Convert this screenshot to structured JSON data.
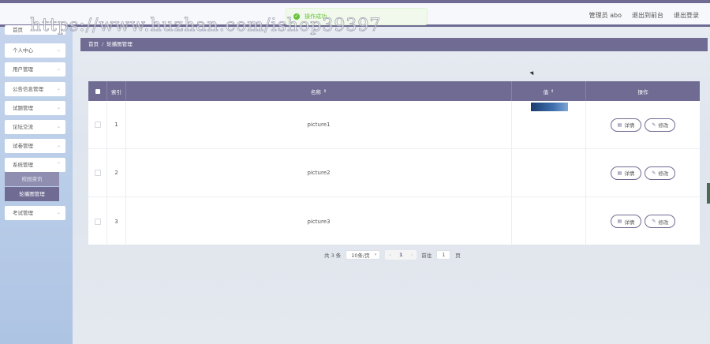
{
  "watermark": "https://www.huzhan.com/ishop39397",
  "toast": {
    "message": "操作成功"
  },
  "header": {
    "user": "管理员 abo",
    "back_to_front": "退出到前台",
    "logout": "退出登录"
  },
  "sidebar": {
    "partial_item": "首页",
    "items": [
      {
        "label": "个人中心"
      },
      {
        "label": "用户管理"
      },
      {
        "label": "公告信息管理"
      },
      {
        "label": "试题管理"
      },
      {
        "label": "论坛交流"
      },
      {
        "label": "试卷管理"
      },
      {
        "label": "系统管理"
      }
    ],
    "submenu": [
      {
        "label": "校园资讯"
      },
      {
        "label": "轮播图管理"
      }
    ],
    "after_items": [
      {
        "label": "考试管理"
      }
    ]
  },
  "breadcrumb": {
    "home": "首页",
    "sep": "/",
    "current": "轮播图管理"
  },
  "table": {
    "headers": {
      "index": "索引",
      "name": "名称",
      "value": "值",
      "actions": "操作"
    },
    "rows": [
      {
        "index": "1",
        "name": "picture1"
      },
      {
        "index": "2",
        "name": "picture2"
      },
      {
        "index": "3",
        "name": "picture3"
      }
    ],
    "detail_label": "详情",
    "edit_label": "修改"
  },
  "pagination": {
    "total": "共 3 条",
    "page_size": "10条/页",
    "current_page": "1",
    "goto_prefix": "前往",
    "goto_value": "1",
    "goto_suffix": "页"
  },
  "colors": {
    "accent": "#6f6b93",
    "success": "#67c23a"
  },
  "icons": {
    "sort": "sort-caret-icon",
    "detail": "document-icon",
    "edit": "pencil-icon"
  }
}
